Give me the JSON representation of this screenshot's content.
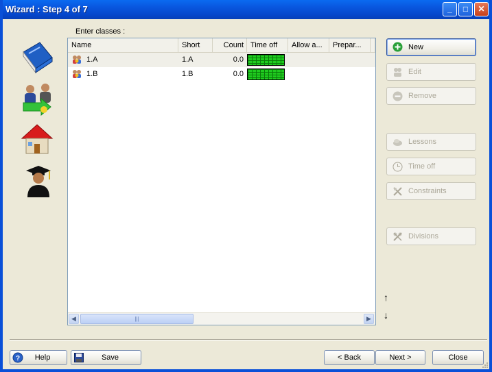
{
  "window": {
    "title": "Wizard : Step 4 of 7"
  },
  "title_buttons": {
    "minimize": "_",
    "maximize": "□",
    "close": "✕"
  },
  "sidebar_icons": [
    "book-icon",
    "users-move-icon",
    "house-icon",
    "teacher-icon"
  ],
  "enter_label": "Enter classes :",
  "table": {
    "columns": [
      "Name",
      "Short",
      "Count",
      "Time off",
      "Allow a...",
      "Prepar...",
      ""
    ],
    "rows": [
      {
        "name": "1.A",
        "short": "1.A",
        "count": "0.0"
      },
      {
        "name": "1.B",
        "short": "1.B",
        "count": "0.0"
      }
    ],
    "scroll_grip": "|||"
  },
  "side_buttons": {
    "new": "New",
    "edit": "Edit",
    "remove": "Remove",
    "lessons": "Lessons",
    "time_off": "Time off",
    "constraints": "Constraints",
    "divisions": "Divisions"
  },
  "move_arrows": {
    "up": "↑",
    "down": "↓"
  },
  "bottom_buttons": {
    "help": "Help",
    "save": "Save",
    "back": "< Back",
    "next": "Next >",
    "close": "Close"
  },
  "colors": {
    "title_bar": "#0958e0",
    "time_off_grid": "#1fcc1f",
    "client_bg": "#ece9d8"
  }
}
